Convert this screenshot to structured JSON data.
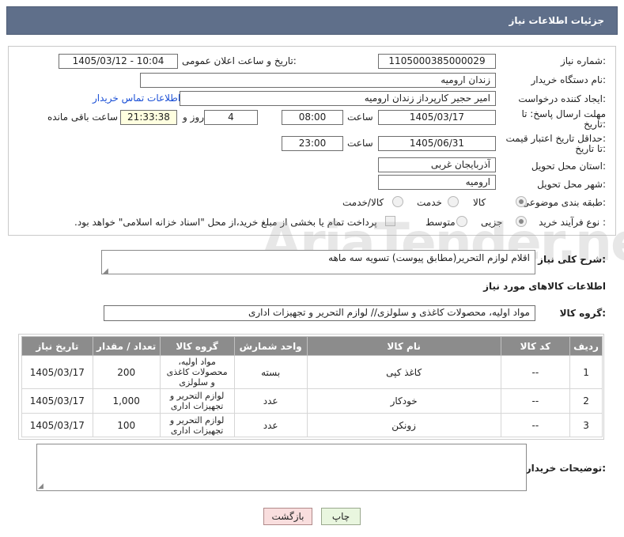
{
  "header": {
    "title": "جزئیات اطلاعات نیاز"
  },
  "fields": {
    "need_number_label": "شماره نیاز:",
    "need_number": "1105000385000029",
    "announce_label": "تاریخ و ساعت اعلان عمومی:",
    "announce_value": "1405/03/12 - 10:04",
    "buyer_label": "نام دستگاه خریدار:",
    "buyer_value": "زندان ارومیه",
    "creator_label": "ایجاد کننده درخواست:",
    "creator_value": "امیر حجیر کارپرداز زندان ارومیه",
    "contact_link": "اطلاعات تماس خریدار",
    "deadline_label_1": "مهلت ارسال پاسخ: تا",
    "deadline_label_2": "تاریخ:",
    "deadline_date": "1405/03/17",
    "time_label": "ساعت",
    "deadline_time": "08:00",
    "days_value": "4",
    "days_label": "روز و",
    "remain_value": "21:33:38",
    "remain_label": "ساعت باقی مانده",
    "validity_label_1": "حداقل تاریخ اعتبار قیمت:",
    "validity_label_2": "تا تاریخ:",
    "validity_date": "1405/06/31",
    "validity_time": "23:00",
    "province_label": "استان محل تحویل:",
    "province_value": "آذربایجان غربی",
    "city_label": "شهر محل تحویل:",
    "city_value": "ارومیه",
    "category_label": "طبقه بندی موضوعی:",
    "category_options": [
      "کالا",
      "خدمت",
      "کالا/خدمت"
    ],
    "purchase_label": "نوع فرآیند خرید :",
    "purchase_options": [
      "جزیی",
      "متوسط"
    ],
    "payment_note": "پرداخت تمام یا بخشی از مبلغ خرید،از محل \"اسناد خزانه اسلامی\" خواهد بود."
  },
  "description": {
    "label": "شرح کلی نیاز:",
    "value": "اقلام لوازم التحریر(مطابق پیوست) تسویه سه ماهه"
  },
  "goods_section": {
    "title": "اطلاعات کالاهای مورد نیاز",
    "group_label": "گروه کالا:",
    "group_value": "مواد اولیه، محصولات کاغذی و سلولزی// لوازم التحریر و تجهیزات اداری"
  },
  "table": {
    "headers": [
      "ردیف",
      "کد کالا",
      "نام کالا",
      "واحد شمارش",
      "گروه کالا",
      "تعداد / مقدار",
      "تاریخ نیاز"
    ],
    "rows": [
      {
        "row": "1",
        "code": "--",
        "name": "کاغذ کپی",
        "unit": "بسته",
        "group": "مواد اولیه، محصولات کاغذی و سلولزی",
        "qty": "200",
        "date": "1405/03/17"
      },
      {
        "row": "2",
        "code": "--",
        "name": "خودکار",
        "unit": "عدد",
        "group": "لوازم التحریر و تجهیزات اداری",
        "qty": "1,000",
        "date": "1405/03/17"
      },
      {
        "row": "3",
        "code": "--",
        "name": "زونکن",
        "unit": "عدد",
        "group": "لوازم التحریر و تجهیزات اداری",
        "qty": "100",
        "date": "1405/03/17"
      }
    ]
  },
  "buyer_notes": {
    "label": "توضیحات خریدار:",
    "value": ""
  },
  "buttons": {
    "print": "چاپ",
    "back": "بازگشت"
  },
  "watermark": "AriaTender.net"
}
